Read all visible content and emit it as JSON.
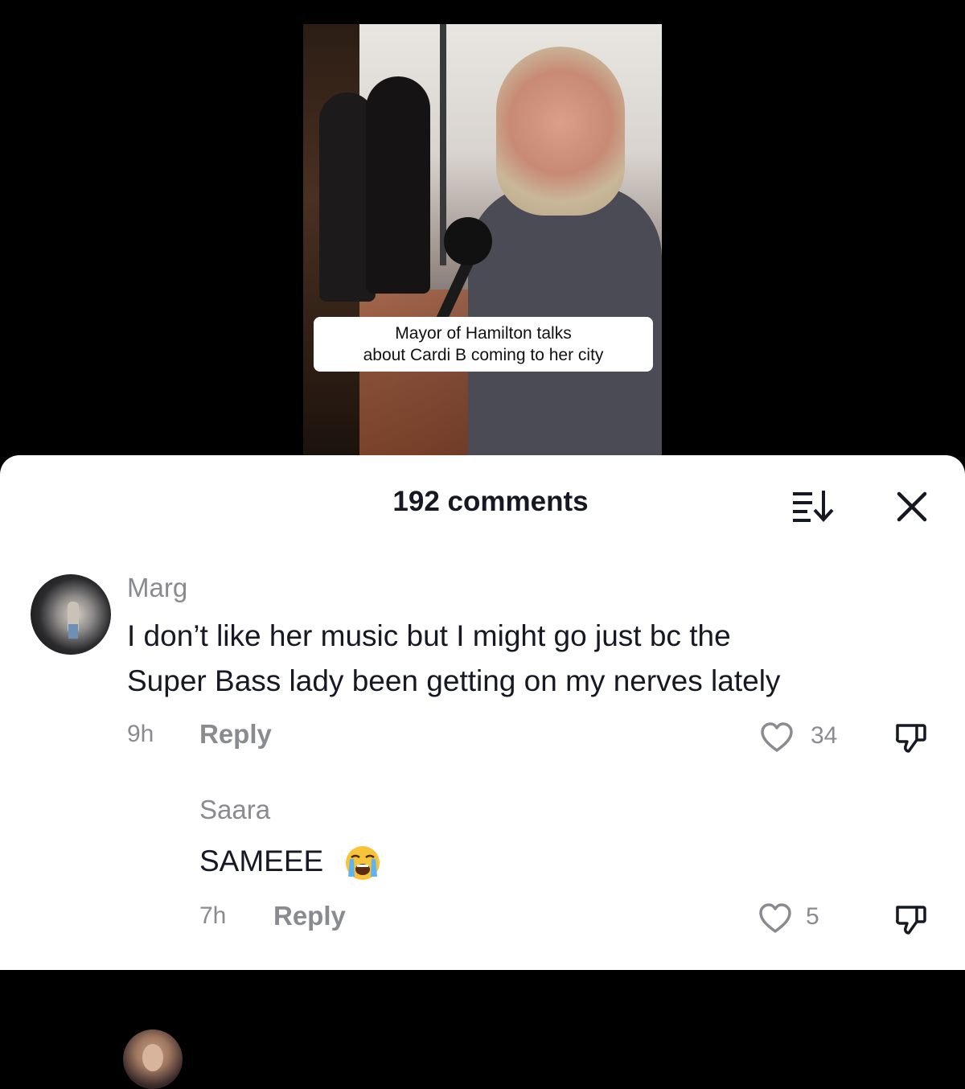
{
  "video": {
    "caption_line1": "Mayor of Hamilton talks",
    "caption_line2": "about Cardi B coming to her city"
  },
  "comments_panel": {
    "title": "192 comments",
    "sort_icon": "sort-descending-icon",
    "close_icon": "close-icon"
  },
  "comments": [
    {
      "username": "Marg",
      "text_line1": "I don’t like her music but I might go just bc the",
      "text_line2": "Super Bass lady been getting on my nerves lately",
      "time": "9h",
      "reply_label": "Reply",
      "likes": "34"
    },
    {
      "username": "Saara",
      "text": "SAMEEE",
      "emoji": "loudly-crying-face-icon",
      "time": "7h",
      "reply_label": "Reply",
      "likes": "5"
    }
  ],
  "colors": {
    "primary_text": "#161823",
    "secondary_text": "#8a8b91",
    "sheet_background": "#ffffff",
    "page_background": "#000000"
  }
}
